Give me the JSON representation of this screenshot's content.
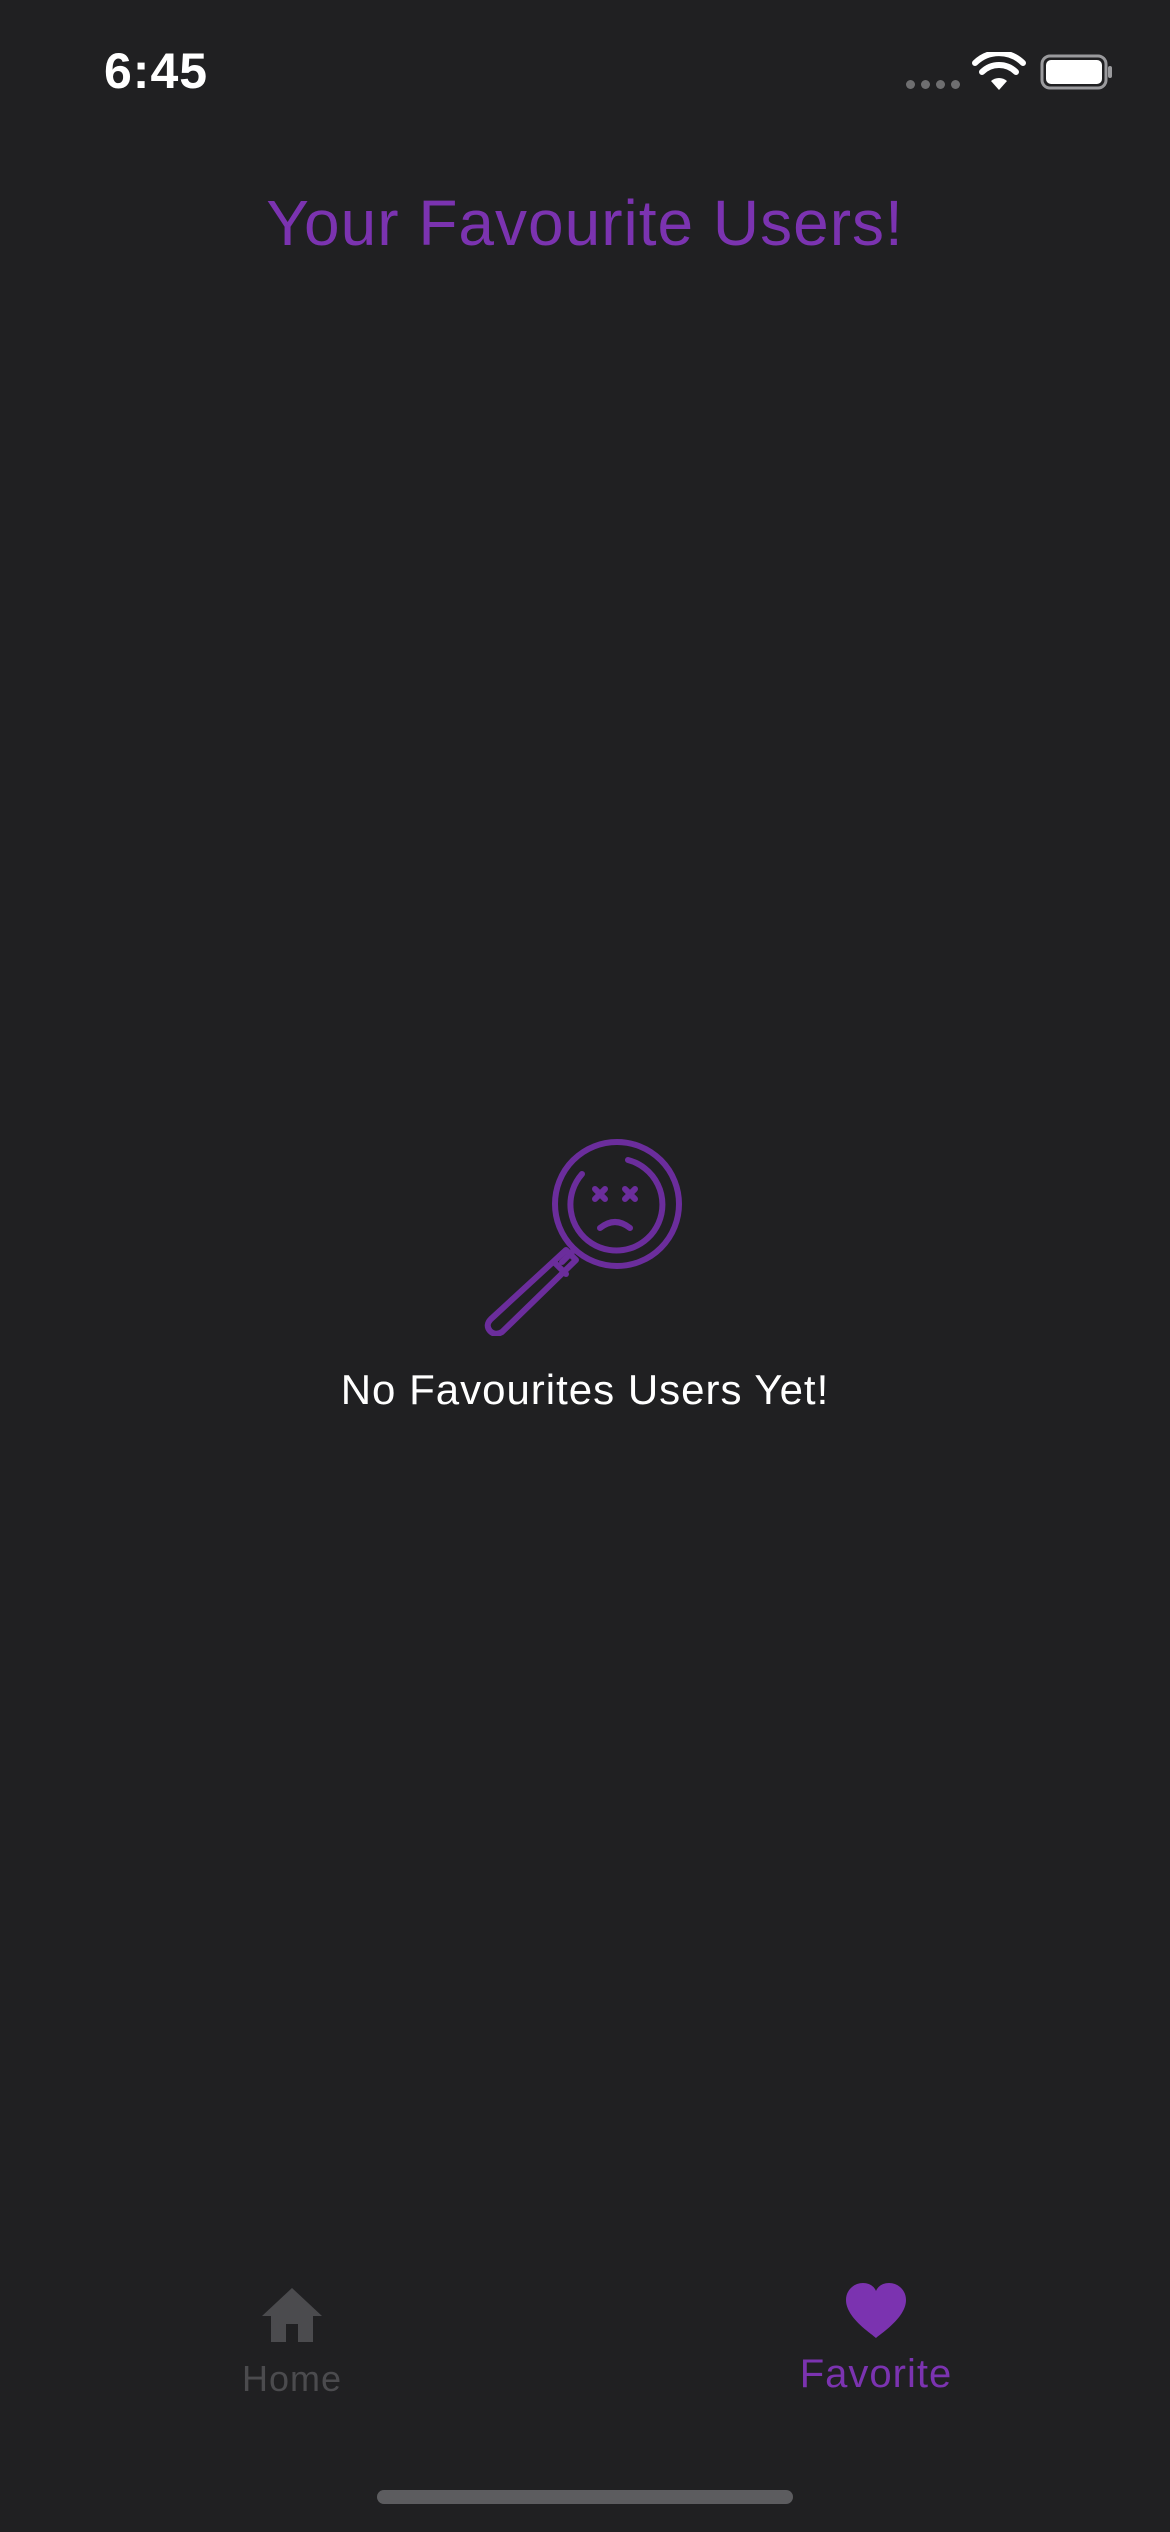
{
  "status_bar": {
    "time": "6:45",
    "icons": [
      "cellular-signal-icon",
      "wifi-icon",
      "battery-icon"
    ]
  },
  "header": {
    "title": "Your Favourite Users!"
  },
  "empty_state": {
    "icon": "sad-magnifier-icon",
    "message": "No Favourites Users Yet!"
  },
  "tab_bar": {
    "tabs": [
      {
        "label": "Home",
        "icon": "home-icon",
        "active": false
      },
      {
        "label": "Favorite",
        "icon": "heart-icon",
        "active": true
      }
    ]
  },
  "colors": {
    "background": "#202022",
    "accent": "#7b33b0",
    "text": "#ffffff",
    "inactive": "#4b4b4e"
  }
}
